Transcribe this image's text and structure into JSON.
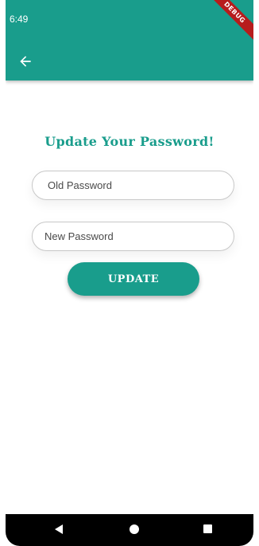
{
  "status_bar": {
    "time": "6:49"
  },
  "app_bar": {
    "back_icon": "arrow-left-icon",
    "debug_banner": "DEBUG",
    "color": "#199d8c"
  },
  "content": {
    "title": "Update Your Password!",
    "old_password": {
      "value": "",
      "placeholder": "Old Password"
    },
    "new_password": {
      "value": "",
      "placeholder": "New Password"
    },
    "update_button_label": "UPDATE"
  },
  "nav_bar": {
    "back_icon": "triangle-back-icon",
    "home_icon": "circle-home-icon",
    "recents_icon": "square-recents-icon"
  }
}
